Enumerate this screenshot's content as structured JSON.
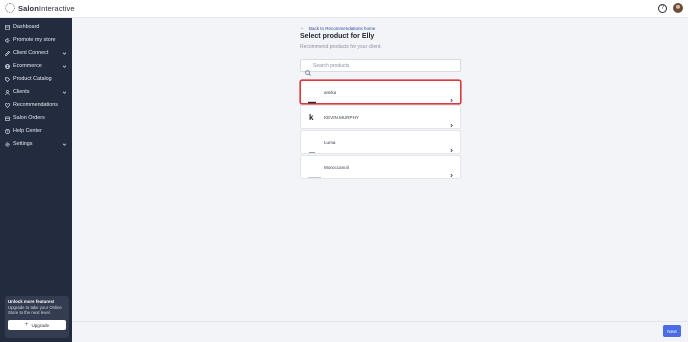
{
  "app": {
    "brand_bold": "Salon",
    "brand_light": "Interactive"
  },
  "sidebar": {
    "items": [
      {
        "label": "Dashboard",
        "icon": "dashboard-icon",
        "has_chevron": false
      },
      {
        "label": "Promote my store",
        "icon": "megaphone-icon",
        "has_chevron": false
      },
      {
        "label": "Client Connect",
        "icon": "pen-icon",
        "has_chevron": true
      },
      {
        "label": "Ecommerce",
        "icon": "globe-icon",
        "has_chevron": true
      },
      {
        "label": "Product Catalog",
        "icon": "tag-icon",
        "has_chevron": false
      },
      {
        "label": "Clients",
        "icon": "person-icon",
        "has_chevron": true
      },
      {
        "label": "Recommendations",
        "icon": "heart-icon",
        "has_chevron": false
      },
      {
        "label": "Salon Orders",
        "icon": "box-icon",
        "has_chevron": false
      },
      {
        "label": "Help Center",
        "icon": "help-icon",
        "has_chevron": false
      },
      {
        "label": "Settings",
        "icon": "gear-icon",
        "has_chevron": true
      }
    ],
    "upgrade": {
      "title": "Unlock more features!",
      "text": "Upgrade to take your Online Store to the next level.",
      "button": "Upgrade"
    }
  },
  "main": {
    "back_link": "Back to Recommendations home",
    "title": "Select product for Elly",
    "subtitle": "Recommend products for your client.",
    "search": {
      "placeholder": "Search products",
      "value": ""
    },
    "brands": [
      {
        "name": "amika",
        "logo": "amika-logo",
        "selected": true
      },
      {
        "name": "KEVIN.MURPHY",
        "logo": "kevin-murphy-logo",
        "selected": false
      },
      {
        "name": "Luma",
        "logo": "luma-logo",
        "selected": false
      },
      {
        "name": "Moroccanoil",
        "logo": "moroccanoil-logo",
        "selected": false
      }
    ]
  },
  "footer": {
    "next_label": "Next"
  },
  "colors": {
    "sidebar_bg": "#232c3f",
    "accent": "#4a6de5",
    "selection_border": "#d9393f",
    "link": "#2c4a9a"
  }
}
